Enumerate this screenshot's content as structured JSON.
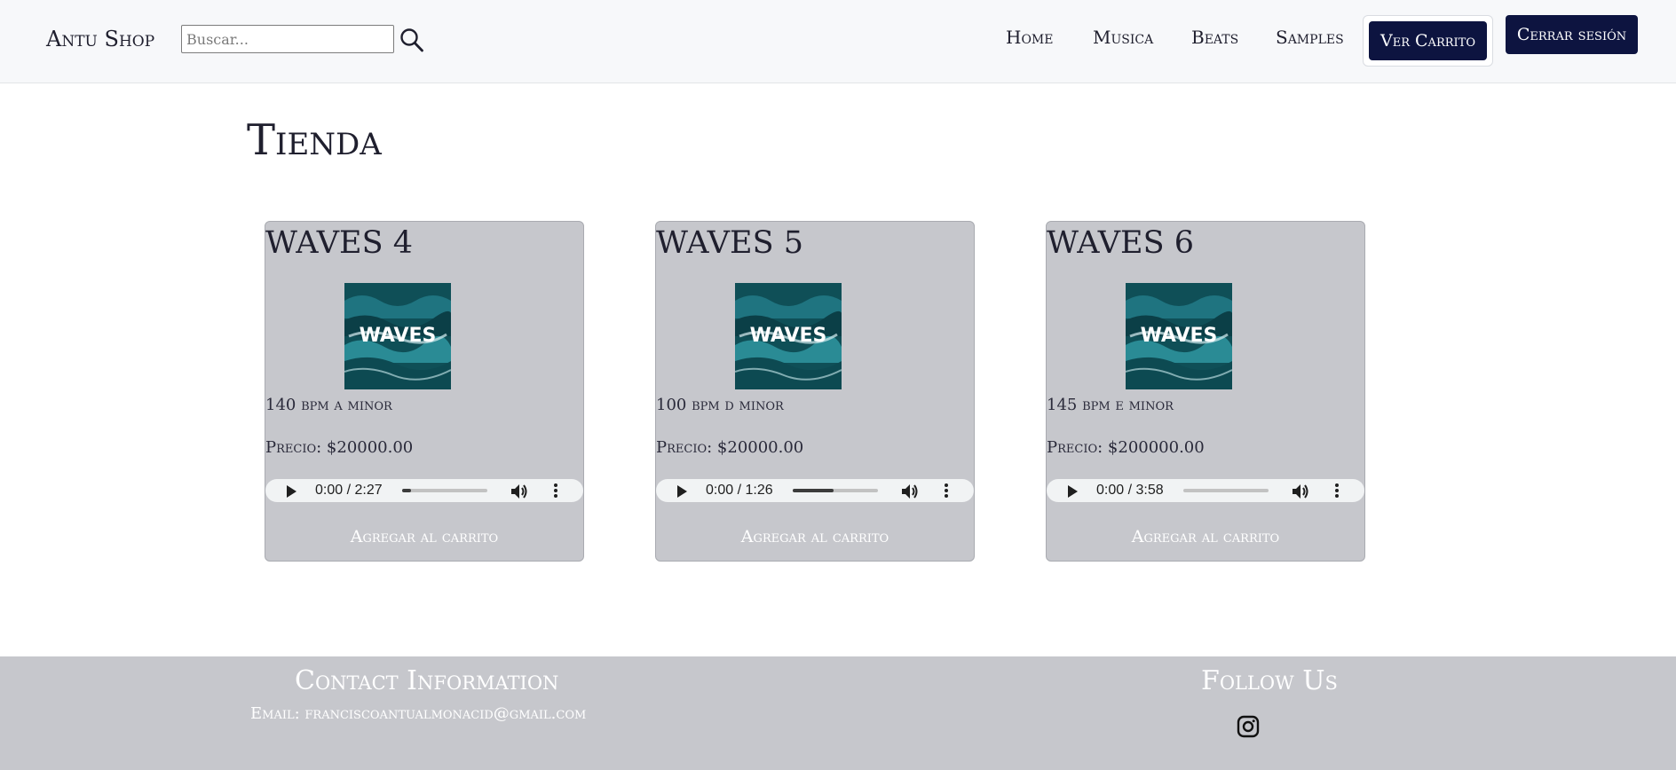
{
  "navbar": {
    "brand": "Antu Shop",
    "search_placeholder": "Buscar...",
    "links": [
      "Home",
      "Musica",
      "Beats",
      "Samples"
    ],
    "cart_button": "Ver Carrito",
    "logout_button": "Cerrar sesión"
  },
  "main": {
    "title": "Tienda",
    "products": [
      {
        "name": "WAVES 4",
        "cover_text": "WAVES",
        "details": "140 bpm a minor",
        "price": "Precio: $20000.00",
        "audio_time": "0:00 / 2:27",
        "progress": 0.1,
        "add_label": "Agregar al carrito"
      },
      {
        "name": "WAVES 5",
        "cover_text": "WAVES",
        "details": "100 bpm d minor",
        "price": "Precio: $20000.00",
        "audio_time": "0:00 / 1:26",
        "progress": 0.48,
        "add_label": "Agregar al carrito"
      },
      {
        "name": "WAVES 6",
        "cover_text": "WAVES",
        "details": "145 bpm e minor",
        "price": "Precio: $200000.00",
        "audio_time": "0:00 / 3:58",
        "progress": 0.0,
        "add_label": "Agregar al carrito"
      }
    ]
  },
  "footer": {
    "contact_title": "Contact Information",
    "email": "Email: franciscoantualmonacid@gmail.com",
    "follow_title": "Follow Us",
    "social_icon": "instagram-icon"
  },
  "colors": {
    "navbar_bg": "#f7f8fa",
    "button_bg": "#0d1440",
    "card_bg": "#c6c7cc",
    "footer_bg": "#c6c7cc"
  }
}
